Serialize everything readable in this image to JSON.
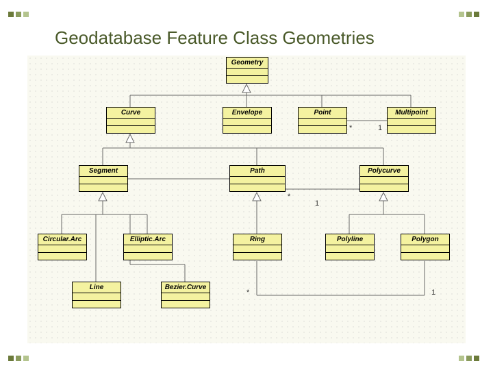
{
  "title": "Geodatabase Feature Class Geometries",
  "classes": {
    "geometry": "Geometry",
    "curve": "Curve",
    "envelope": "Envelope",
    "point": "Point",
    "multipoint": "Multipoint",
    "segment": "Segment",
    "path": "Path",
    "polycurve": "Polycurve",
    "circulararc": "Circular.Arc",
    "ellipticarc": "Elliptic.Arc",
    "ring": "Ring",
    "polyline": "Polyline",
    "polygon": "Polygon",
    "line": "Line",
    "beziercurve": "Bezier.Curve"
  },
  "mult": {
    "star": "*",
    "one": "1"
  }
}
